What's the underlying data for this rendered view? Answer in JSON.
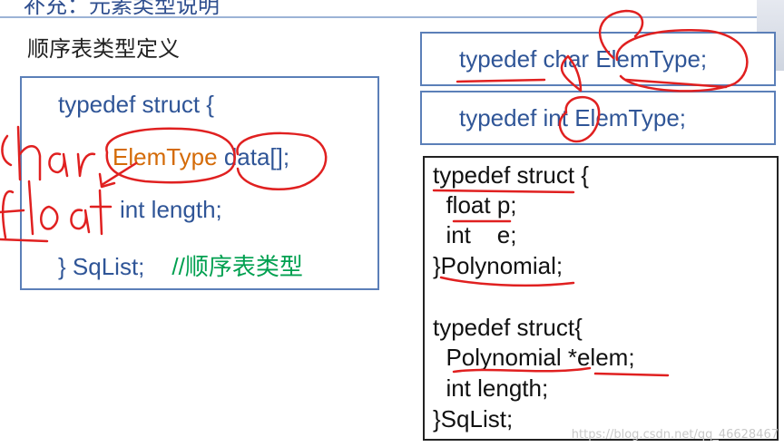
{
  "header": {
    "title": "补充：元素类型说明"
  },
  "section_heading": "顺序表类型定义",
  "left_box": {
    "line1": "typedef struct {",
    "elem_type": "ElemType",
    "data_decl": " data[];",
    "line3": "int length;",
    "line4_code": "} SqList;",
    "line4_comment": "//顺序表类型"
  },
  "right_top": {
    "box1": "typedef char ElemType;",
    "box2": "typedef int ElemType;"
  },
  "right_bottom": {
    "lines": [
      "typedef struct {",
      "  float p;",
      "  int    e;",
      "}Polynomial;",
      "",
      "typedef struct{",
      "  Polynomial *elem;",
      "  int length;",
      "}SqList;"
    ]
  },
  "handwriting": {
    "word1": "char",
    "word2": "float"
  },
  "watermark": "https://blog.csdn.net/qq_46628467",
  "colors": {
    "annotation_red": "#e02020",
    "code_blue": "#2f5597",
    "elemtype_orange": "#d46b08",
    "comment_green": "#00a050"
  }
}
